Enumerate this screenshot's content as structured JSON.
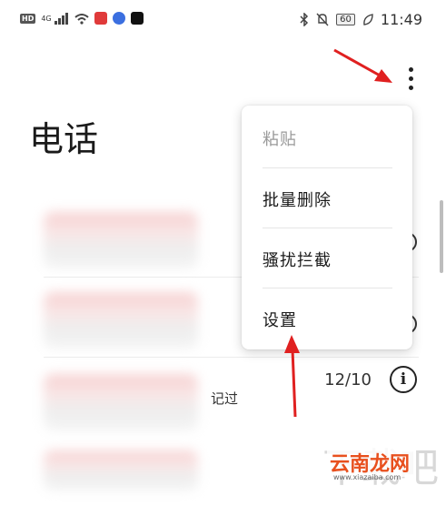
{
  "status_bar": {
    "hd": "HD",
    "network": "4G",
    "battery": "60",
    "time": "11:49",
    "icons": [
      "signal-icon",
      "wifi-icon",
      "bluetooth-icon",
      "mute-icon",
      "leaf-icon"
    ]
  },
  "header": {
    "title": "电话",
    "more_icon": "more-vertical-icon"
  },
  "menu": {
    "items": [
      {
        "label": "粘贴",
        "enabled": false
      },
      {
        "label": "批量删除",
        "enabled": true
      },
      {
        "label": "骚扰拦截",
        "enabled": true
      },
      {
        "label": "设置",
        "enabled": true
      }
    ]
  },
  "call_list": {
    "items": [
      {
        "date": "",
        "sub": ""
      },
      {
        "date": "",
        "sub": ""
      },
      {
        "date": "12/10",
        "sub": "记过"
      }
    ]
  },
  "watermark": {
    "logo_text": "云南龙网",
    "bg_text": "下载吧",
    "url": "www.xiazaiba.com"
  },
  "colors": {
    "annotation_arrow": "#e02020",
    "watermark_orange": "#e8501e"
  }
}
